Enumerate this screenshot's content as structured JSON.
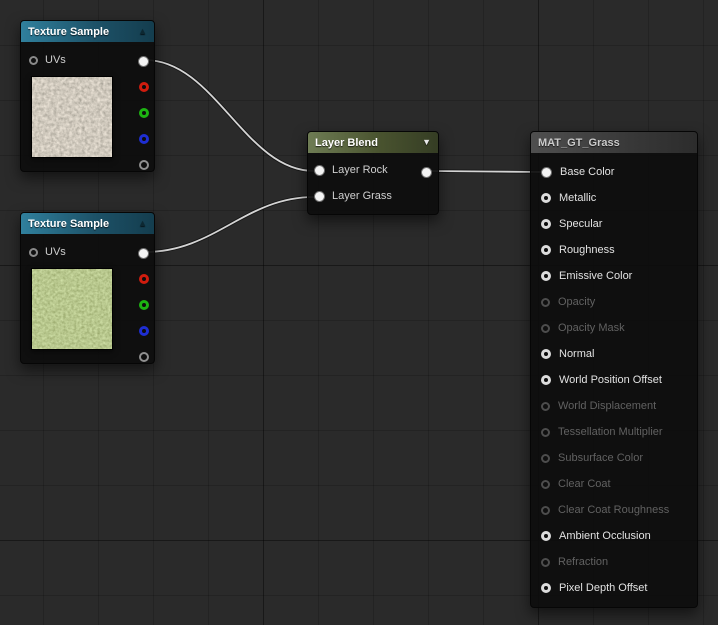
{
  "canvas": {
    "bg": "#2a2a2a",
    "grid_minor": "#242424",
    "grid_major": "#1d1d1d",
    "wire_color": "#d4d4d4"
  },
  "icons": {
    "collapse_up": "▲",
    "dropdown_down": "▼"
  },
  "pin_colors": {
    "rgb": "#f4f4f4",
    "r": "#d01c0e",
    "g": "#1db512",
    "b": "#1e2ed2",
    "a": "#8f8f8f"
  },
  "nodes": {
    "texture_sample_rock": {
      "title": "Texture Sample",
      "uvs_label": "UVs",
      "texture": "rock",
      "outputs": [
        "RGB",
        "R",
        "G",
        "B",
        "A"
      ]
    },
    "texture_sample_grass": {
      "title": "Texture Sample",
      "uvs_label": "UVs",
      "texture": "grass",
      "outputs": [
        "RGB",
        "R",
        "G",
        "B",
        "A"
      ]
    },
    "layer_blend": {
      "title": "Layer Blend",
      "inputs": [
        {
          "label": "Layer Rock"
        },
        {
          "label": "Layer Grass"
        }
      ]
    },
    "material": {
      "title": "MAT_GT_Grass",
      "pins": [
        {
          "label": "Base Color",
          "enabled": true,
          "connected": true
        },
        {
          "label": "Metallic",
          "enabled": true,
          "connected": false
        },
        {
          "label": "Specular",
          "enabled": true,
          "connected": false
        },
        {
          "label": "Roughness",
          "enabled": true,
          "connected": false
        },
        {
          "label": "Emissive Color",
          "enabled": true,
          "connected": false
        },
        {
          "label": "Opacity",
          "enabled": false,
          "connected": false
        },
        {
          "label": "Opacity Mask",
          "enabled": false,
          "connected": false
        },
        {
          "label": "Normal",
          "enabled": true,
          "connected": false
        },
        {
          "label": "World Position Offset",
          "enabled": true,
          "connected": false
        },
        {
          "label": "World Displacement",
          "enabled": false,
          "connected": false
        },
        {
          "label": "Tessellation Multiplier",
          "enabled": false,
          "connected": false
        },
        {
          "label": "Subsurface Color",
          "enabled": false,
          "connected": false
        },
        {
          "label": "Clear Coat",
          "enabled": false,
          "connected": false
        },
        {
          "label": "Clear Coat Roughness",
          "enabled": false,
          "connected": false
        },
        {
          "label": "Ambient Occlusion",
          "enabled": true,
          "connected": false
        },
        {
          "label": "Refraction",
          "enabled": false,
          "connected": false
        },
        {
          "label": "Pixel Depth Offset",
          "enabled": true,
          "connected": false
        }
      ]
    }
  },
  "connections": [
    {
      "from": "texture_sample_rock.RGB",
      "to": "layer_blend.Layer Rock"
    },
    {
      "from": "texture_sample_grass.RGB",
      "to": "layer_blend.Layer Grass"
    },
    {
      "from": "layer_blend.Output",
      "to": "material.Base Color"
    }
  ]
}
